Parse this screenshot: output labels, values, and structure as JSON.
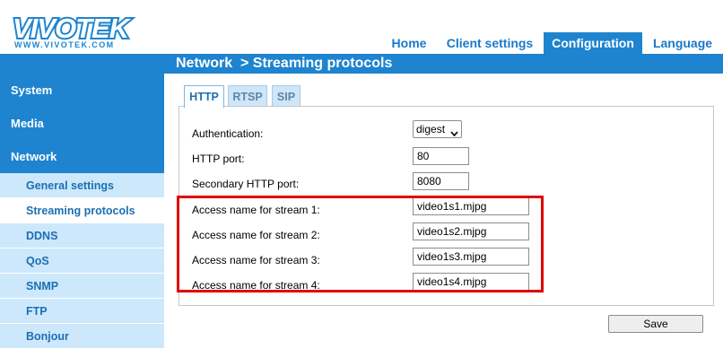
{
  "brand": {
    "name": "VIVOTEK",
    "url": "WWW.VIVOTEK.COM",
    "color": "#1e84cf"
  },
  "nav": {
    "home": "Home",
    "client_settings": "Client settings",
    "configuration": "Configuration",
    "language": "Language"
  },
  "page_title": "Network  > Streaming protocols",
  "sidebar": {
    "main": [
      "System",
      "Media",
      "Network"
    ],
    "sub": [
      "General settings",
      "Streaming protocols",
      "DDNS",
      "QoS",
      "SNMP",
      "FTP",
      "Bonjour"
    ],
    "active": "Streaming protocols"
  },
  "tabs": [
    "HTTP",
    "RTSP",
    "SIP"
  ],
  "form": {
    "authentication_label": "Authentication:",
    "authentication_value": "digest",
    "http_port_label": "HTTP port:",
    "http_port_value": "80",
    "secondary_http_port_label": "Secondary HTTP port:",
    "secondary_http_port_value": "8080",
    "streams": [
      {
        "label": "Access name for stream 1:",
        "value": "video1s1.mjpg"
      },
      {
        "label": "Access name for stream 2:",
        "value": "video1s2.mjpg"
      },
      {
        "label": "Access name for stream 3:",
        "value": "video1s3.mjpg"
      },
      {
        "label": "Access name for stream 4:",
        "value": "video1s4.mjpg"
      }
    ]
  },
  "save_label": "Save",
  "colors": {
    "accent": "#1e84cf",
    "sidebar_sub_bg": "#cde8fb",
    "highlight": "#e00000"
  }
}
